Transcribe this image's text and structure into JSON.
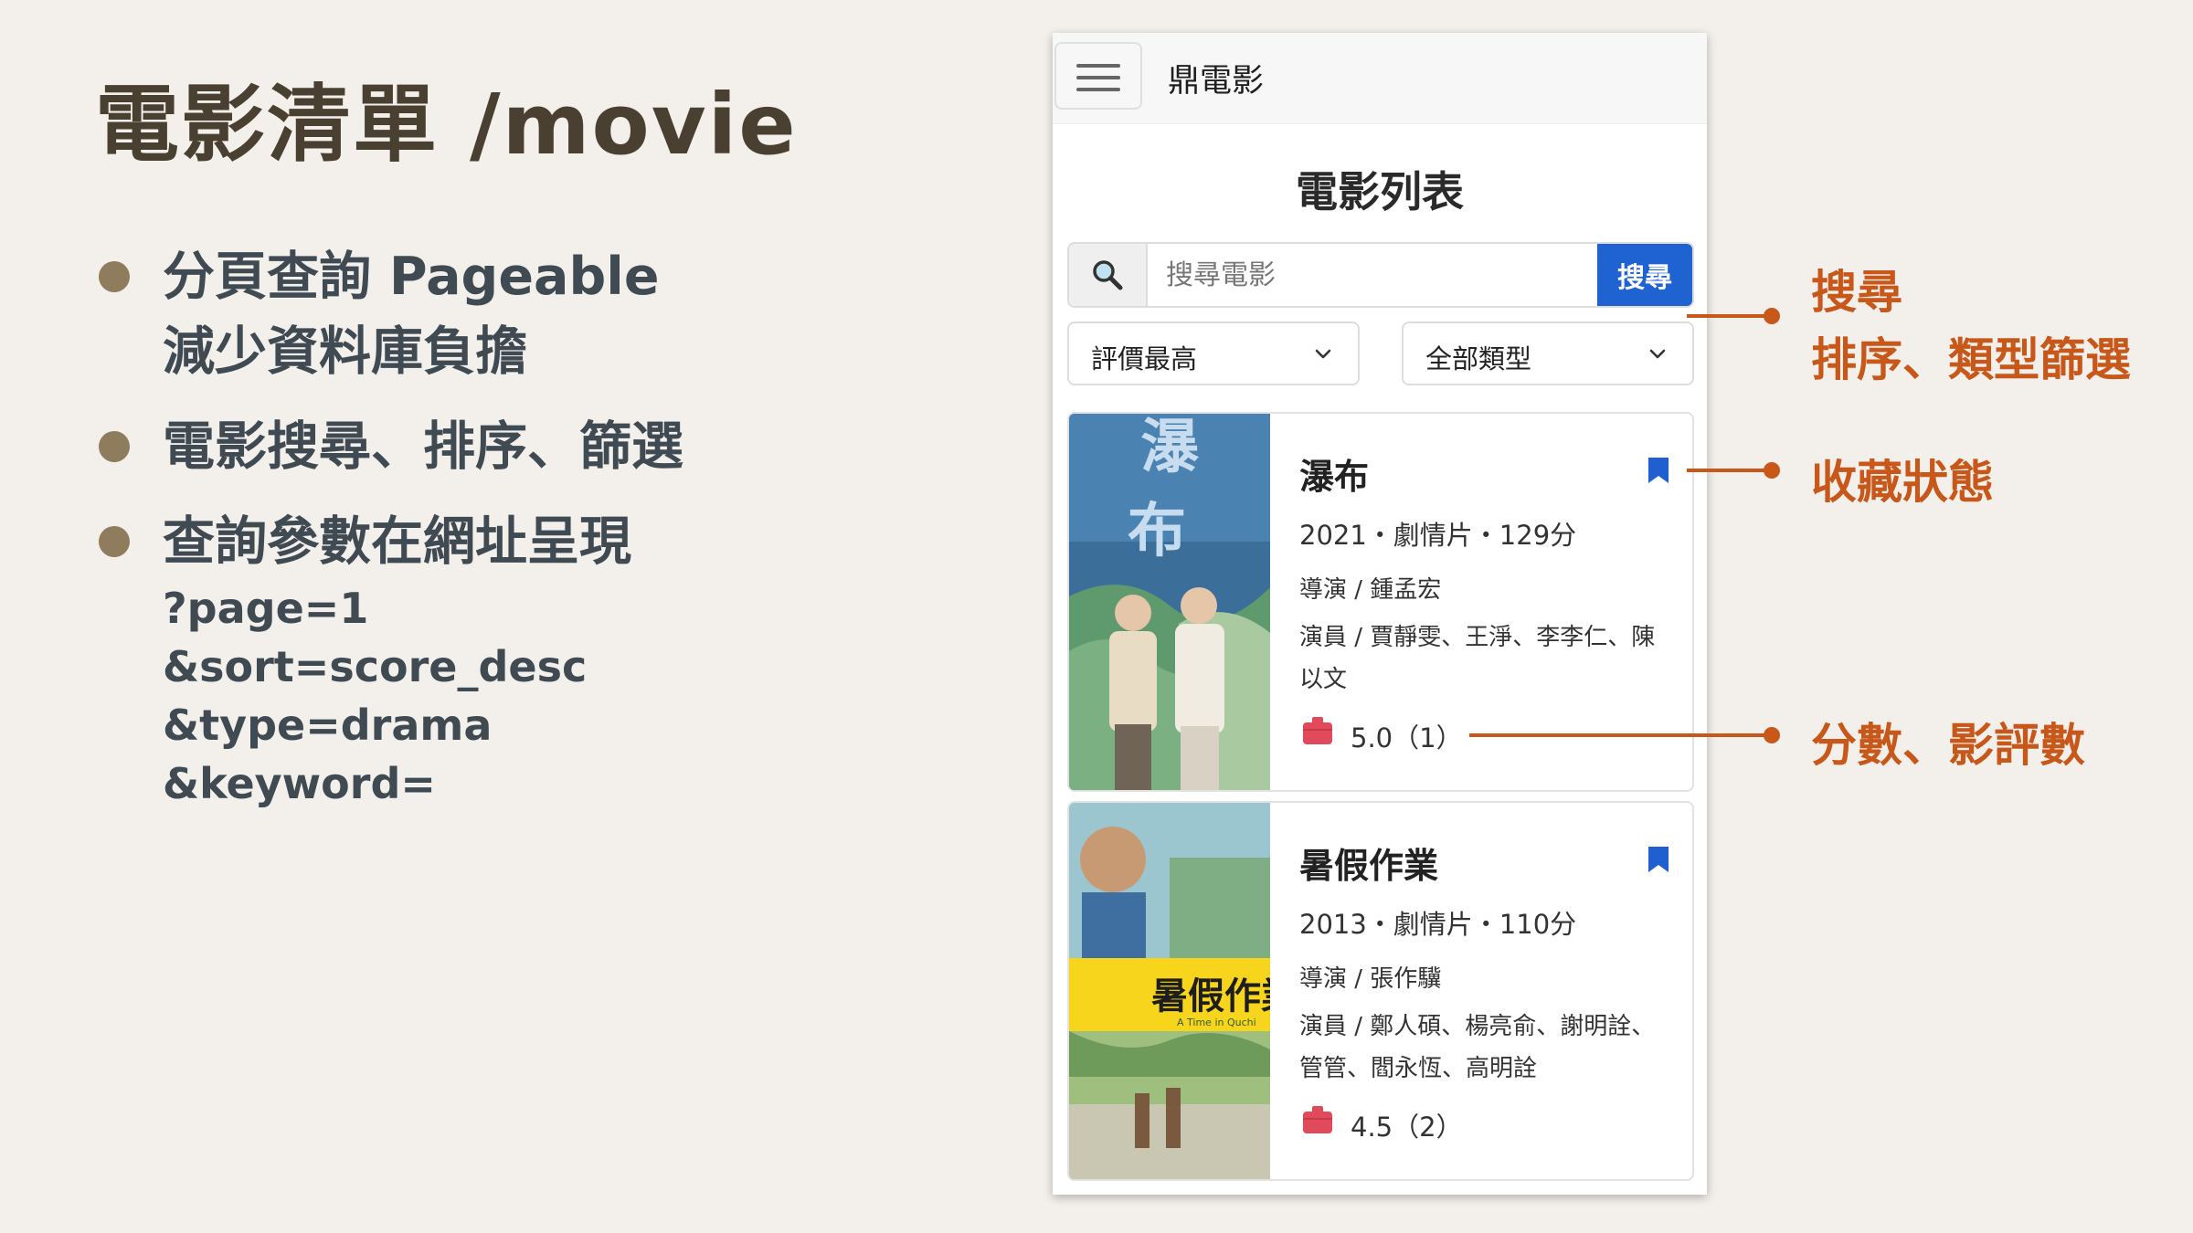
{
  "slide": {
    "title": "電影清單 /movie",
    "bullets": [
      {
        "lines": [
          "分頁查詢 Pageable",
          "減少資料庫負擔"
        ]
      },
      {
        "lines": [
          "電影搜尋、排序、篩選"
        ]
      },
      {
        "lines": [
          "查詢參數在網址呈現"
        ],
        "params": [
          "?page=1",
          "&sort=score_desc",
          "&type=drama",
          "&keyword="
        ]
      }
    ]
  },
  "phone": {
    "brand": "鼎電影",
    "heading": "電影列表",
    "search": {
      "placeholder": "搜尋電影",
      "value": "",
      "button": "搜尋"
    },
    "sort_select": "評價最高",
    "type_select": "全部類型",
    "movies": [
      {
        "title": "瀑布",
        "meta": "2021・劇情片・129分",
        "director": "導演 / 鍾孟宏",
        "cast": "演員 / 賈靜雯、王淨、李李仁、陳以文",
        "rating": "5.0（1）",
        "bookmarked": true,
        "poster_text": {
          "line1": "瀑",
          "line2": "布"
        }
      },
      {
        "title": "暑假作業",
        "meta": "2013・劇情片・110分",
        "director": "導演 / 張作驥",
        "cast": "演員 / 鄭人碩、楊亮俞、謝明詮、管管、閻永恆、高明詮",
        "rating": "4.5（2）",
        "bookmarked": true,
        "poster_text": {
          "title": "暑假作業",
          "subtitle": "A Time in Quchi"
        }
      }
    ]
  },
  "annotations": {
    "search": "搜尋",
    "sort_filter": "排序、類型篩選",
    "bookmark": "收藏狀態",
    "rating": "分數、影評數"
  },
  "colors": {
    "background": "#f3f0ec",
    "title": "#4a4032",
    "text": "#3f4a52",
    "bullet_dot": "#8f7c5c",
    "accent": "#c8571a",
    "primary_button": "#1f62d2",
    "rating_icon": "#e04a5a"
  },
  "icons": [
    "hamburger-icon",
    "search-icon",
    "chevron-down-icon",
    "bookmark-icon",
    "popcorn-icon"
  ]
}
